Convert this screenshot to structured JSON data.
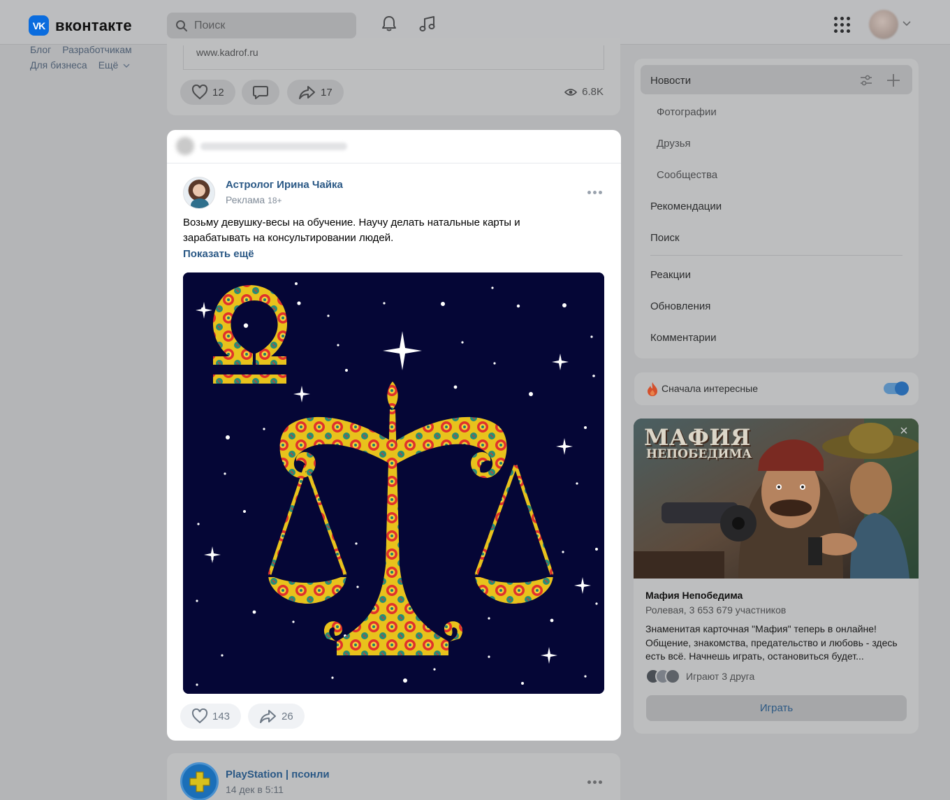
{
  "header": {
    "logo_mark": "VK",
    "logo_text": "вконтакте",
    "search_placeholder": "Поиск"
  },
  "left_links": {
    "row1": [
      "Блог",
      "Разработчикам"
    ],
    "row2": [
      "Для бизнеса",
      "Ещё"
    ]
  },
  "post_top": {
    "link": "www.kadrof.ru",
    "likes": "12",
    "shares": "17",
    "views": "6.8K"
  },
  "post_main": {
    "author": "Астролог Ирина Чайка",
    "meta": "Реклама",
    "age": "18+",
    "text": "Возьму девушку-весы на обучение. Научу делать натальные карты и зарабатывать на консультировании людей.",
    "show_more": "Показать ещё",
    "likes": "143",
    "shares": "26"
  },
  "post_bottom": {
    "author": "PlayStation | псонли",
    "date": "14 дек в 5:11"
  },
  "menu": {
    "active": "Новости",
    "subitems": [
      "Фотографии",
      "Друзья",
      "Сообщества"
    ],
    "items": [
      "Рекомендации",
      "Поиск"
    ],
    "items2": [
      "Реакции",
      "Обновления",
      "Комментарии"
    ]
  },
  "toggle": {
    "label": "Сначала интересные",
    "on": true
  },
  "ad": {
    "image_title_1": "МАФИЯ",
    "image_title_2": "НЕПОБЕДИМА",
    "name": "Мафия Непобедима",
    "sub": "Ролевая, 3 653 679 участников",
    "desc": "Знаменитая карточная \"Мафия\" теперь в онлайне! Общение, знакомства, предательство и любовь - здесь есть всё. Начнешь играть, остановиться будет...",
    "friends": "Играют 3 друга",
    "button": "Играть"
  },
  "colors": {
    "brand": "#0a6cde",
    "link": "#2a5885",
    "image_bg": "#050636"
  }
}
